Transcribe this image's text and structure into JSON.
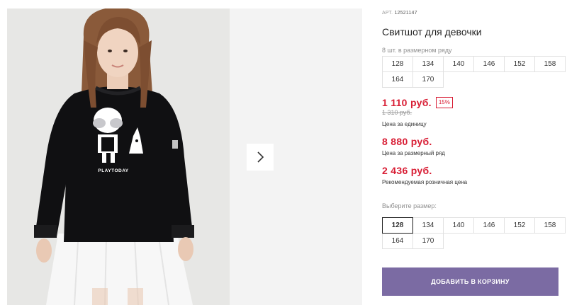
{
  "gallery": {
    "print_text": "PLAYTODAY",
    "next_icon": "chevron-right-icon"
  },
  "product": {
    "article_label": "АРТ.",
    "article_value": "12521147",
    "title": "Свитшот для девочки",
    "pack_note": "8 шт. в размерном ряду",
    "pack_sizes": [
      "128",
      "134",
      "140",
      "146",
      "152",
      "158",
      "164",
      "170"
    ],
    "unit_price": "1 110 руб.",
    "discount": "15%",
    "old_price": "1 310 руб.",
    "unit_price_label": "Цена за единицу",
    "pack_price": "8 880 руб.",
    "pack_price_label": "Цена за размерный ряд",
    "retail_price": "2 436 руб.",
    "retail_price_label": "Рекомендуемая розничная цена",
    "choose_size_label": "Выберите размер:",
    "sizes": [
      "128",
      "134",
      "140",
      "146",
      "152",
      "158",
      "164",
      "170"
    ],
    "selected_size": "128",
    "add_to_cart_label": "ДОБАВИТЬ В КОРЗИНУ"
  },
  "colors": {
    "price_red": "#d81d34",
    "button_purple": "#7b6ba3",
    "photo_background": "#e7e7e5"
  }
}
